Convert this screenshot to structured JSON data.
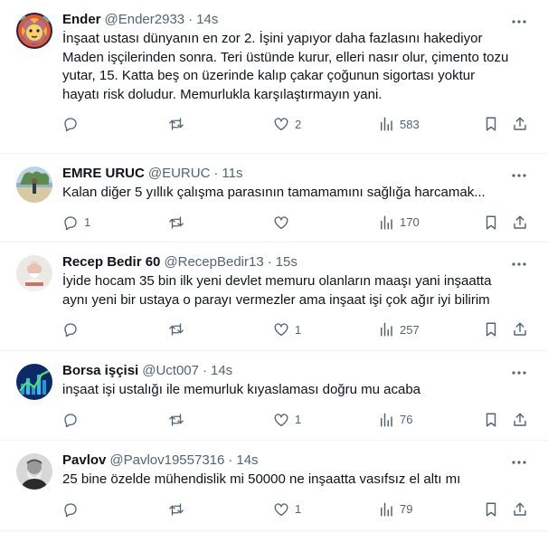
{
  "tweets": [
    {
      "name": "Ender",
      "handle": "@Ender2933",
      "time": "14s",
      "text": "İnşaat ustası dünyanın en zor 2. İşini yapıyor daha fazlasını hakediyor Maden işçilerinden sonra. Teri üstünde kurur, elleri nasır olur, çimento tozu yutar, 15. Katta beş on üzerinde kalıp çakar çoğunun sigortası yoktur hayatı risk doludur. Memurlukla karşılaştırmayın yani.",
      "replies": "",
      "retweets": "",
      "likes": "2",
      "views": "583",
      "avatar_icon": "lion-avatar"
    },
    {
      "name": "EMRE URUC",
      "handle": "@EURUC",
      "time": "11s",
      "text": "Kalan diğer 5 yıllık çalışma parasının tamamamını sağlığa harcamak...",
      "replies": "1",
      "retweets": "",
      "likes": "",
      "views": "170",
      "avatar_icon": "beach-avatar"
    },
    {
      "name": "Recep Bedir 60",
      "handle": "@RecepBedir13",
      "time": "15s",
      "text": "İyide hocam 35 bin ilk yeni devlet memuru olanların maaşı yani inşaatta aynı yeni bir ustaya o parayı vermezler ama inşaat işi çok ağır iyi bilirim",
      "replies": "",
      "retweets": "",
      "likes": "1",
      "views": "257",
      "avatar_icon": "person-avatar"
    },
    {
      "name": "Borsa işçisi",
      "handle": "@Uct007",
      "time": "14s",
      "text": "inşaat işi ustalığı ile memurluk kıyaslaması doğru mu acaba",
      "replies": "",
      "retweets": "",
      "likes": "1",
      "views": "76",
      "avatar_icon": "chart-avatar"
    },
    {
      "name": "Pavlov",
      "handle": "@Pavlov19557316",
      "time": "14s",
      "text": "25 bine özelde mühendislik mi 50000 ne inşaatta vasıfsız el altı mı",
      "replies": "",
      "retweets": "",
      "likes": "1",
      "views": "79",
      "avatar_icon": "portrait-avatar"
    }
  ],
  "separator": "·",
  "colors": {
    "text": "#0f1419",
    "secondary": "#536471",
    "border": "#eff3f4"
  }
}
